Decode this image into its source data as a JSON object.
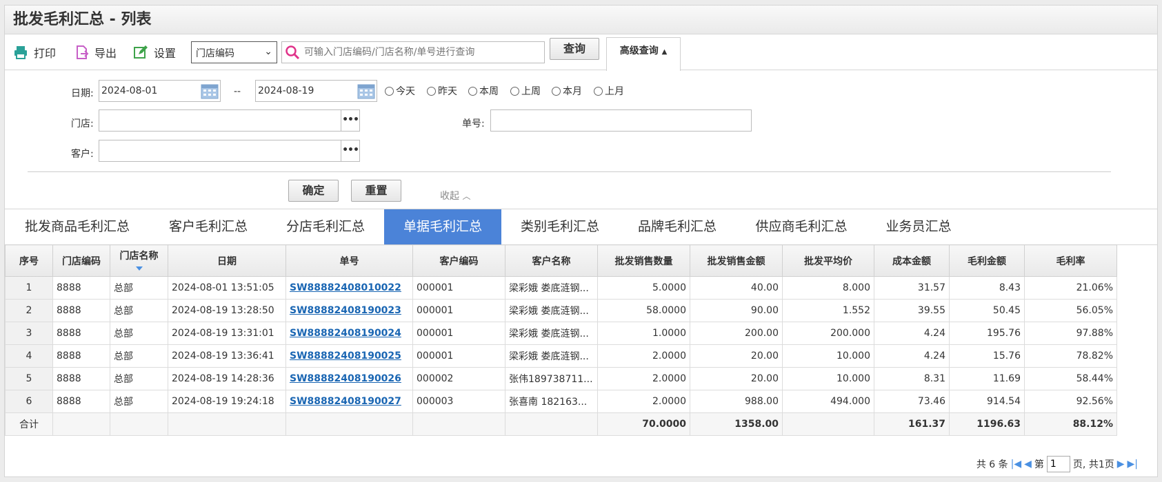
{
  "title": "批发毛利汇总 - 列表",
  "toolbar": {
    "print": "打印",
    "export": "导出",
    "settings": "设置",
    "select_value": "门店编码",
    "search_placeholder": "可输入门店编码/门店名称/单号进行查询",
    "query": "查询",
    "advanced": "高级查询"
  },
  "filters": {
    "date_label": "日期:",
    "date_from": "2024-08-01",
    "date_sep": "--",
    "date_to": "2024-08-19",
    "quick": [
      "今天",
      "昨天",
      "本周",
      "上周",
      "本月",
      "上月"
    ],
    "store_label": "门店:",
    "store_value": "",
    "order_label": "单号:",
    "order_value": "",
    "customer_label": "客户:",
    "customer_value": "",
    "confirm": "确定",
    "reset": "重置",
    "collapse": "收起"
  },
  "tabs": [
    "批发商品毛利汇总",
    "客户毛利汇总",
    "分店毛利汇总",
    "单据毛利汇总",
    "类别毛利汇总",
    "品牌毛利汇总",
    "供应商毛利汇总",
    "业务员汇总"
  ],
  "active_tab": 3,
  "table": {
    "columns": [
      "序号",
      "门店编码",
      "门店名称",
      "日期",
      "单号",
      "客户编码",
      "客户名称",
      "批发销售数量",
      "批发销售金额",
      "批发平均价",
      "成本金额",
      "毛利金额",
      "毛利率"
    ],
    "rows": [
      [
        "1",
        "8888",
        "总部",
        "2024-08-01 13:51:05",
        "SW88882408010022",
        "000001",
        "梁彩娥 娄底涟钢...",
        "5.0000",
        "40.00",
        "8.000",
        "31.57",
        "8.43",
        "21.06%"
      ],
      [
        "2",
        "8888",
        "总部",
        "2024-08-19 13:28:50",
        "SW88882408190023",
        "000001",
        "梁彩娥 娄底涟钢...",
        "58.0000",
        "90.00",
        "1.552",
        "39.55",
        "50.45",
        "56.05%"
      ],
      [
        "3",
        "8888",
        "总部",
        "2024-08-19 13:31:01",
        "SW88882408190024",
        "000001",
        "梁彩娥 娄底涟钢...",
        "1.0000",
        "200.00",
        "200.000",
        "4.24",
        "195.76",
        "97.88%"
      ],
      [
        "4",
        "8888",
        "总部",
        "2024-08-19 13:36:41",
        "SW88882408190025",
        "000001",
        "梁彩娥 娄底涟钢...",
        "2.0000",
        "20.00",
        "10.000",
        "4.24",
        "15.76",
        "78.82%"
      ],
      [
        "5",
        "8888",
        "总部",
        "2024-08-19 14:28:36",
        "SW88882408190026",
        "000002",
        "张伟189738711...",
        "2.0000",
        "20.00",
        "10.000",
        "8.31",
        "11.69",
        "58.44%"
      ],
      [
        "6",
        "8888",
        "总部",
        "2024-08-19 19:24:18",
        "SW88882408190027",
        "000003",
        "张喜南 182163...",
        "2.0000",
        "988.00",
        "494.000",
        "73.46",
        "914.54",
        "92.56%"
      ]
    ],
    "total": {
      "label": "合计",
      "qty": "70.0000",
      "amount": "1358.00",
      "cost": "161.37",
      "profit": "1196.63",
      "rate": "88.12%"
    }
  },
  "pager": {
    "count": "共 6 条",
    "page_prefix": "第",
    "page": "1",
    "page_suffix": "页, 共1页"
  }
}
